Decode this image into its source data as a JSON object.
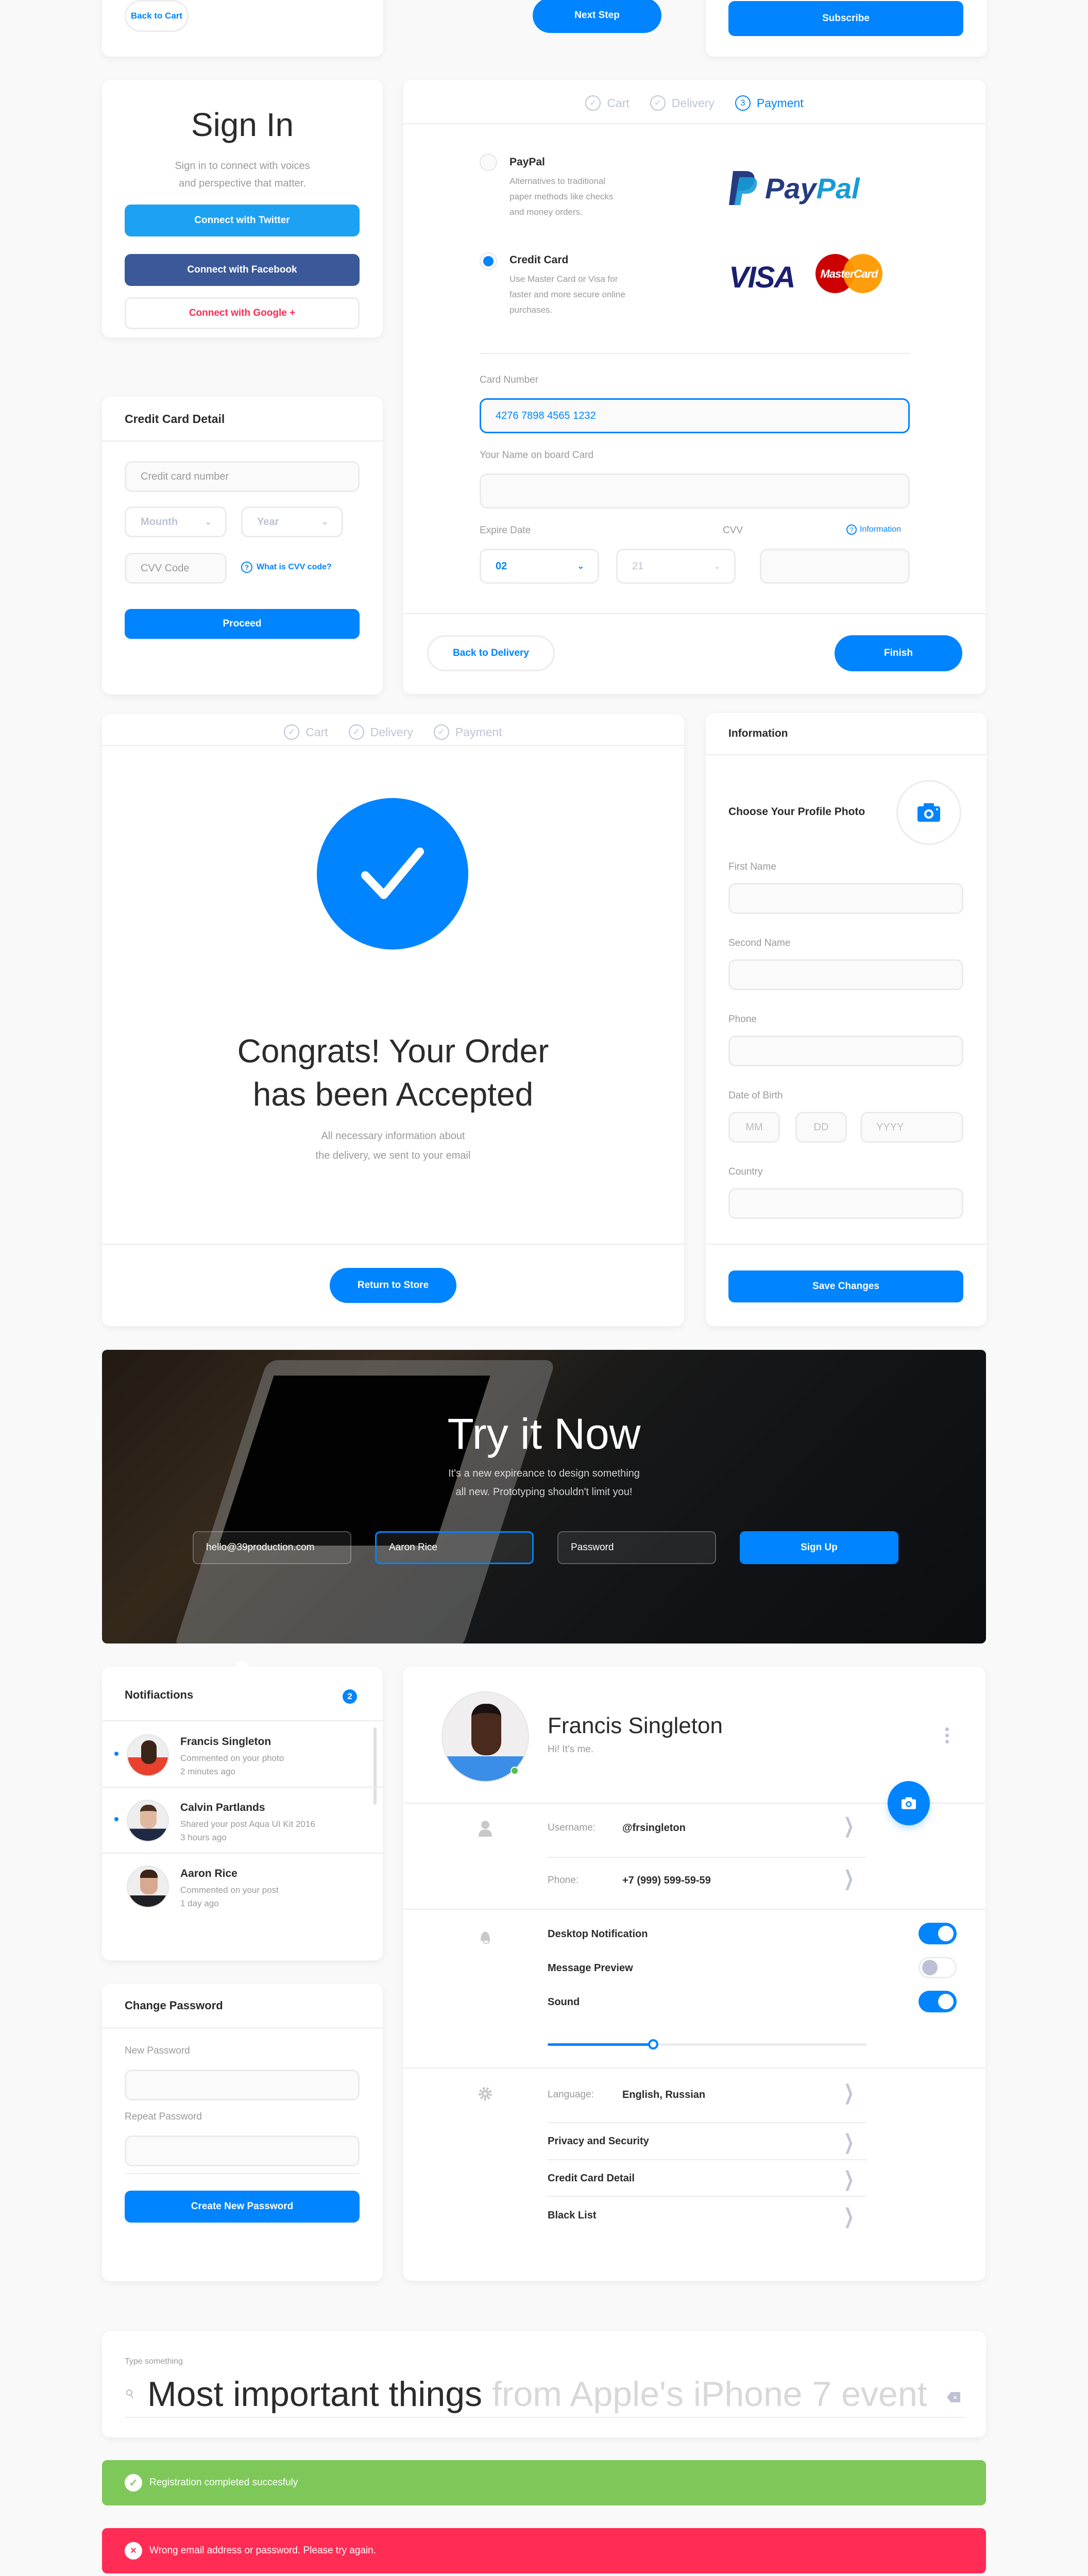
{
  "top": {
    "back_to_cart": "Back to Cart",
    "next_step": "Next Step",
    "subscribe": "Subscribe"
  },
  "signin": {
    "title": "Sign In",
    "subtitle_1": "Sign in to connect with voices",
    "subtitle_2": "and perspective that matter.",
    "twitter": "Connect with Twitter",
    "facebook": "Connect with Facebook",
    "google": "Connect with Google +",
    "colors": {
      "twitter": "#1da1f2",
      "facebook": "#3b5998",
      "google": "#ff2d55"
    }
  },
  "cc_detail": {
    "title": "Credit Card Detail",
    "number_placeholder": "Credit card number",
    "month_placeholder": "Mounth",
    "year_placeholder": "Year",
    "cvv_placeholder": "CVV Code",
    "cvv_help": "What is CVV code?",
    "proceed": "Proceed"
  },
  "payment": {
    "steps": [
      {
        "label": "Cart",
        "icon": "check"
      },
      {
        "label": "Delivery",
        "icon": "check"
      },
      {
        "label": "Payment",
        "icon": "3"
      }
    ],
    "options": [
      {
        "title": "PayPal",
        "desc_1": "Alternatives to traditional",
        "desc_2": "paper methods like checks",
        "desc_3": "and money orders.",
        "selected": false
      },
      {
        "title": "Credit Card",
        "desc_1": "Use Master Card or Visa for",
        "desc_2": "faster and more secure online",
        "desc_3": "purchases.",
        "selected": true
      }
    ],
    "logos": {
      "paypal_pay": "Pay",
      "paypal_pal": "Pal",
      "visa": "VISA",
      "mastercard": "MasterCard"
    },
    "card_number_label": "Card Number",
    "card_number_value": "4276 7898 4565 1232",
    "name_label": "Your Name on board Card",
    "expire_label": "Expire Date",
    "cvv_label": "CVV",
    "info_link": "Information",
    "month_value": "02",
    "year_value": "21",
    "back": "Back to Delivery",
    "finish": "Finish"
  },
  "congrats": {
    "steps": [
      "Cart",
      "Delivery",
      "Payment"
    ],
    "title_1": "Congrats! Your Order",
    "title_2": "has been Accepted",
    "desc_1": "All necessary information about",
    "desc_2": "the delivery, we sent to your email",
    "return": "Return to Store"
  },
  "information": {
    "title": "Information",
    "choose_photo": "Choose Your Profile Photo",
    "first_name": "First Name",
    "second_name": "Second Name",
    "phone": "Phone",
    "dob": "Date of Birth",
    "mm": "MM",
    "dd": "DD",
    "yyyy": "YYYY",
    "country": "Country",
    "save": "Save Changes"
  },
  "hero": {
    "title": "Try it Now",
    "sub_1": "It's a new expireance to design something",
    "sub_2": "all new. Prototyping shouldn't limit you!",
    "email_value": "hello@39production.com",
    "name_value": "Aaron Rice",
    "password_placeholder": "Password",
    "signup": "Sign Up"
  },
  "notifications": {
    "title": "Notifiactions",
    "count": "2",
    "items": [
      {
        "name": "Francis Singleton",
        "action": "Commented on your photo",
        "time": "2 minutes ago",
        "unread": true
      },
      {
        "name": "Calvin Partlands",
        "action": "Shared your post Aqua UI Kit 2016",
        "time": "3 hours ago",
        "unread": true
      },
      {
        "name": "Aaron Rice",
        "action": "Commented on your post",
        "time": "1 day ago",
        "unread": false
      }
    ]
  },
  "change_password": {
    "title": "Change Password",
    "new_label": "New Password",
    "repeat_label": "Repeat Password",
    "create": "Create New Password"
  },
  "profile": {
    "name": "Francis Singleton",
    "status": "Hi!  It's me.",
    "online": true,
    "username_label": "Username:",
    "username": "@frsingleton",
    "phone_label": "Phone:",
    "phone": "+7 (999) 599-59-59",
    "toggles": [
      {
        "label": "Desktop Notification",
        "on": true
      },
      {
        "label": "Message Preview",
        "on": false
      },
      {
        "label": "Sound",
        "on": true
      }
    ],
    "volume_percent": 33,
    "language_label": "Language:",
    "language": "English, Russian",
    "links": [
      "Privacy and Security",
      "Credit Card Detail",
      "Black List"
    ]
  },
  "search": {
    "label": "Type something",
    "typed": "Most important things",
    "suggestion": " from Apple's iPhone 7 event"
  },
  "alerts": {
    "success": "Registration completed succesfuly",
    "error": "Wrong email address or password. Please try again.",
    "colors": {
      "success": "#7ec85a",
      "error": "#ff2d55"
    }
  },
  "colors": {
    "accent": "#0084ff",
    "bg": "#f9f9f9"
  }
}
